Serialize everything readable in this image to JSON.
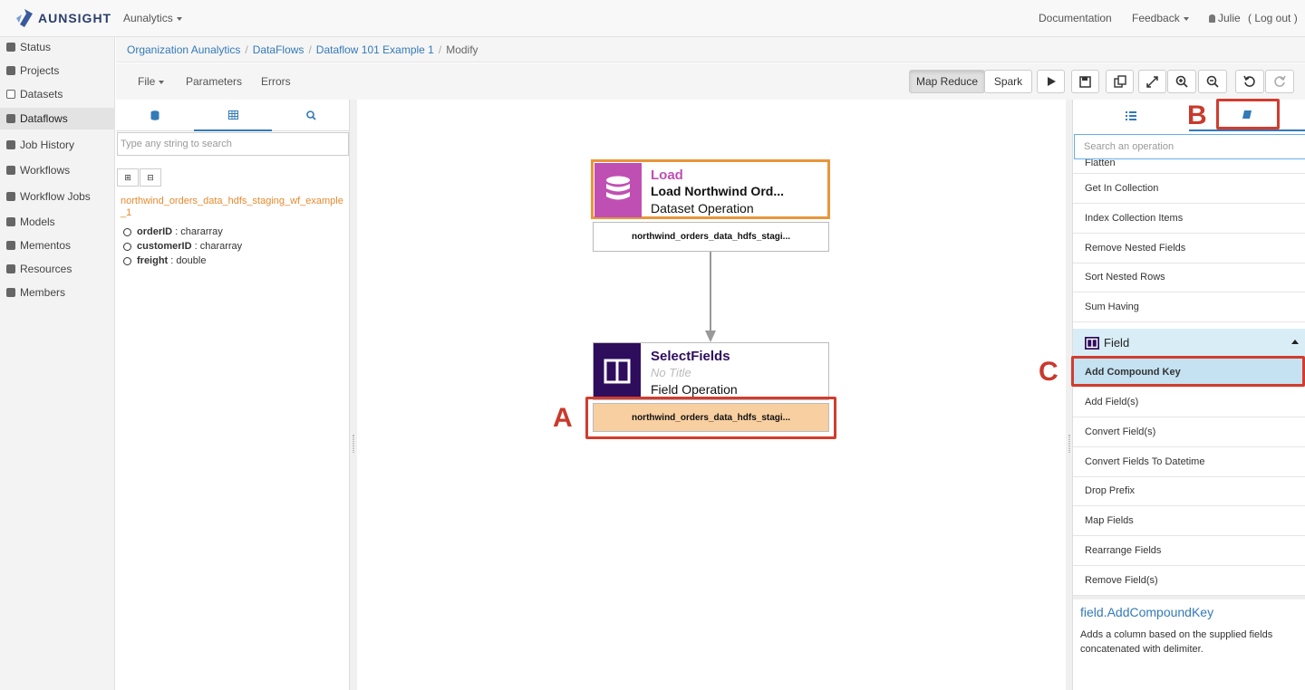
{
  "brand": {
    "name": "AUNSIGHT"
  },
  "topnav": {
    "org_menu": "Aunalytics",
    "documentation": "Documentation",
    "feedback": "Feedback",
    "user": "Julie",
    "logout": "( Log out )"
  },
  "sidebar": {
    "items": [
      {
        "label": "Status",
        "icon": "dashboard-icon"
      },
      {
        "label": "Projects",
        "icon": "list-icon"
      },
      {
        "label": "Datasets",
        "icon": "file-icon"
      },
      {
        "label": "Dataflows",
        "icon": "sitemap-icon"
      },
      {
        "label": "Job History",
        "icon": "sitemap-icon"
      },
      {
        "label": "Workflows",
        "icon": "workflow-icon"
      },
      {
        "label": "Workflow Jobs",
        "icon": "workflow-icon"
      },
      {
        "label": "Models",
        "icon": "arrow-icon"
      },
      {
        "label": "Mementos",
        "icon": "note-icon"
      },
      {
        "label": "Resources",
        "icon": "server-icon"
      },
      {
        "label": "Members",
        "icon": "users-icon"
      }
    ]
  },
  "breadcrumb": {
    "items": [
      "Organization Aunalytics",
      "DataFlows",
      "Dataflow 101 Example 1"
    ],
    "current": "Modify"
  },
  "toolbar": {
    "file": "File",
    "parameters": "Parameters",
    "errors": "Errors",
    "map_reduce": "Map Reduce",
    "spark": "Spark"
  },
  "left_panel": {
    "search_placeholder": "Type any string to search",
    "dataset_name": "northwind_orders_data_hdfs_staging_wf_example_1",
    "fields": [
      {
        "name": "orderID",
        "type": ": chararray"
      },
      {
        "name": "customerID",
        "type": ": chararray"
      },
      {
        "name": "freight",
        "type": ": double"
      }
    ]
  },
  "canvas": {
    "load_node": {
      "kind": "Load",
      "title": "Load Northwind Ord...",
      "type": "Dataset Operation",
      "output": "northwind_orders_data_hdfs_stagi..."
    },
    "select_node": {
      "kind": "SelectFields",
      "title": "No Title",
      "type": "Field Operation",
      "output": "northwind_orders_data_hdfs_stagi..."
    }
  },
  "annotations": {
    "a": "A",
    "b": "B",
    "c": "C"
  },
  "right_panel": {
    "search_placeholder": "Search an operation",
    "ops_before": [
      "Flatten",
      "Get In Collection",
      "Index Collection Items",
      "Remove Nested Fields",
      "Sort Nested Rows",
      "Sum Having"
    ],
    "group": "Field",
    "selected_op": "Add Compound Key",
    "ops_after": [
      "Add Field(s)",
      "Convert Field(s)",
      "Convert Fields To Datetime",
      "Drop Prefix",
      "Map Fields",
      "Rearrange Fields",
      "Remove Field(s)"
    ],
    "desc_title": "field.AddCompoundKey",
    "desc_text": "Adds a column based on the supplied fields concatenated with delimiter."
  },
  "colors": {
    "load_accent": "#c04fb3",
    "select_accent": "#2e0d5c",
    "output_selected": "#f8cfa0",
    "annotation_red": "#d23c2e",
    "link_blue": "#337ab7"
  }
}
